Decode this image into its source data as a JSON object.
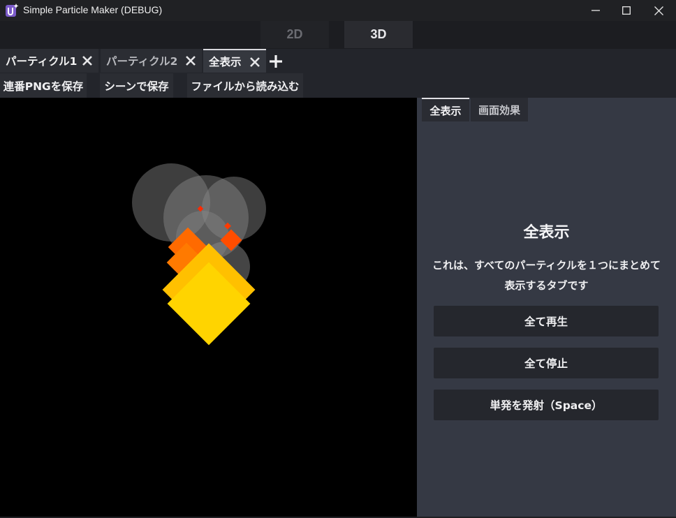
{
  "window": {
    "title": "Simple Particle Maker (DEBUG)",
    "icon": "app-logo-icon"
  },
  "mode": {
    "options": [
      "2D",
      "3D"
    ],
    "selected": "3D"
  },
  "tabs": [
    {
      "label": "パーティクル1",
      "active": false
    },
    {
      "label": "パーティクル2",
      "active": false
    },
    {
      "label": "全表示",
      "active": true
    }
  ],
  "toolbar": {
    "save_png_label": "連番PNGを保存",
    "save_scene_label": "シーンで保存",
    "load_file_label": "ファイルから読み込む"
  },
  "panel": {
    "tabs": [
      "全表示",
      "画面効果"
    ],
    "heading": "全表示",
    "description": "これは、すべてのパーティクルを１つにまとめて表示するタブです",
    "buttons": {
      "play_all": "全て再生",
      "stop_all": "全て停止",
      "emit_once": "単発を発射（Space）"
    }
  },
  "colors": {
    "smoke": "#8a8a8a",
    "flame_yellow": "#ffd400",
    "flame_orange": "#ff7a00",
    "flame_red": "#ff4d00",
    "panel_bg": "#353944"
  }
}
